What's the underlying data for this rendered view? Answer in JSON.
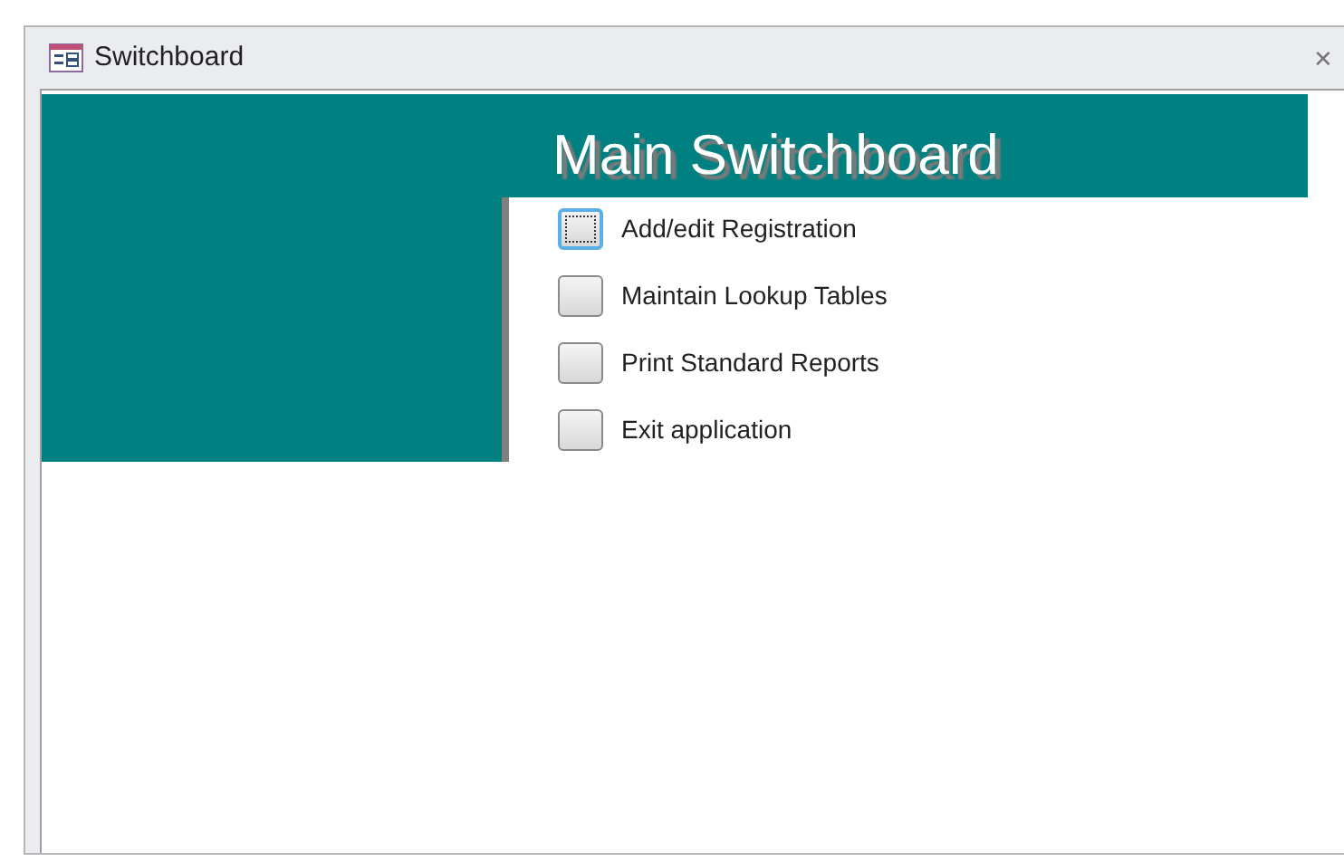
{
  "window": {
    "title": "Switchboard",
    "close": "✕"
  },
  "header": {
    "title": "Main Switchboard"
  },
  "items": [
    {
      "label": "Add/edit Registration",
      "selected": true
    },
    {
      "label": "Maintain Lookup Tables",
      "selected": false
    },
    {
      "label": "Print Standard Reports",
      "selected": false
    },
    {
      "label": "Exit application",
      "selected": false
    }
  ]
}
